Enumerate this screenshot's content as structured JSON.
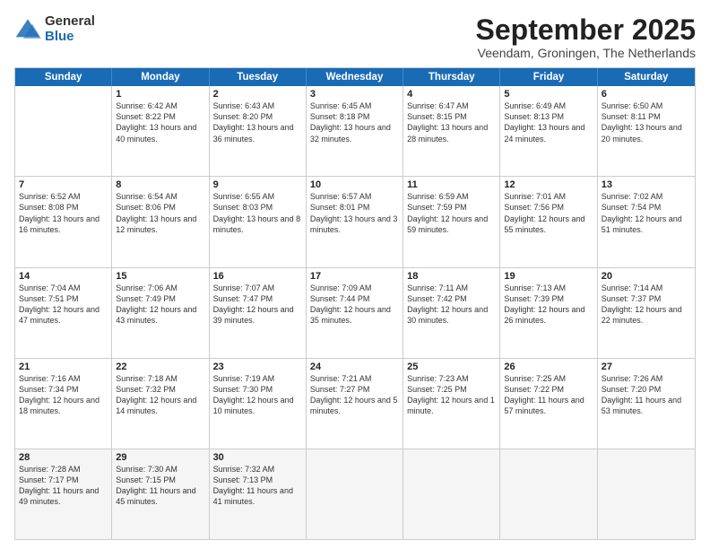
{
  "logo": {
    "general": "General",
    "blue": "Blue"
  },
  "title": {
    "month": "September 2025",
    "location": "Veendam, Groningen, The Netherlands"
  },
  "header": {
    "days": [
      "Sunday",
      "Monday",
      "Tuesday",
      "Wednesday",
      "Thursday",
      "Friday",
      "Saturday"
    ]
  },
  "weeks": [
    [
      {
        "day": "",
        "sunrise": "",
        "sunset": "",
        "daylight": ""
      },
      {
        "day": "1",
        "sunrise": "Sunrise: 6:42 AM",
        "sunset": "Sunset: 8:22 PM",
        "daylight": "Daylight: 13 hours and 40 minutes."
      },
      {
        "day": "2",
        "sunrise": "Sunrise: 6:43 AM",
        "sunset": "Sunset: 8:20 PM",
        "daylight": "Daylight: 13 hours and 36 minutes."
      },
      {
        "day": "3",
        "sunrise": "Sunrise: 6:45 AM",
        "sunset": "Sunset: 8:18 PM",
        "daylight": "Daylight: 13 hours and 32 minutes."
      },
      {
        "day": "4",
        "sunrise": "Sunrise: 6:47 AM",
        "sunset": "Sunset: 8:15 PM",
        "daylight": "Daylight: 13 hours and 28 minutes."
      },
      {
        "day": "5",
        "sunrise": "Sunrise: 6:49 AM",
        "sunset": "Sunset: 8:13 PM",
        "daylight": "Daylight: 13 hours and 24 minutes."
      },
      {
        "day": "6",
        "sunrise": "Sunrise: 6:50 AM",
        "sunset": "Sunset: 8:11 PM",
        "daylight": "Daylight: 13 hours and 20 minutes."
      }
    ],
    [
      {
        "day": "7",
        "sunrise": "Sunrise: 6:52 AM",
        "sunset": "Sunset: 8:08 PM",
        "daylight": "Daylight: 13 hours and 16 minutes."
      },
      {
        "day": "8",
        "sunrise": "Sunrise: 6:54 AM",
        "sunset": "Sunset: 8:06 PM",
        "daylight": "Daylight: 13 hours and 12 minutes."
      },
      {
        "day": "9",
        "sunrise": "Sunrise: 6:55 AM",
        "sunset": "Sunset: 8:03 PM",
        "daylight": "Daylight: 13 hours and 8 minutes."
      },
      {
        "day": "10",
        "sunrise": "Sunrise: 6:57 AM",
        "sunset": "Sunset: 8:01 PM",
        "daylight": "Daylight: 13 hours and 3 minutes."
      },
      {
        "day": "11",
        "sunrise": "Sunrise: 6:59 AM",
        "sunset": "Sunset: 7:59 PM",
        "daylight": "Daylight: 12 hours and 59 minutes."
      },
      {
        "day": "12",
        "sunrise": "Sunrise: 7:01 AM",
        "sunset": "Sunset: 7:56 PM",
        "daylight": "Daylight: 12 hours and 55 minutes."
      },
      {
        "day": "13",
        "sunrise": "Sunrise: 7:02 AM",
        "sunset": "Sunset: 7:54 PM",
        "daylight": "Daylight: 12 hours and 51 minutes."
      }
    ],
    [
      {
        "day": "14",
        "sunrise": "Sunrise: 7:04 AM",
        "sunset": "Sunset: 7:51 PM",
        "daylight": "Daylight: 12 hours and 47 minutes."
      },
      {
        "day": "15",
        "sunrise": "Sunrise: 7:06 AM",
        "sunset": "Sunset: 7:49 PM",
        "daylight": "Daylight: 12 hours and 43 minutes."
      },
      {
        "day": "16",
        "sunrise": "Sunrise: 7:07 AM",
        "sunset": "Sunset: 7:47 PM",
        "daylight": "Daylight: 12 hours and 39 minutes."
      },
      {
        "day": "17",
        "sunrise": "Sunrise: 7:09 AM",
        "sunset": "Sunset: 7:44 PM",
        "daylight": "Daylight: 12 hours and 35 minutes."
      },
      {
        "day": "18",
        "sunrise": "Sunrise: 7:11 AM",
        "sunset": "Sunset: 7:42 PM",
        "daylight": "Daylight: 12 hours and 30 minutes."
      },
      {
        "day": "19",
        "sunrise": "Sunrise: 7:13 AM",
        "sunset": "Sunset: 7:39 PM",
        "daylight": "Daylight: 12 hours and 26 minutes."
      },
      {
        "day": "20",
        "sunrise": "Sunrise: 7:14 AM",
        "sunset": "Sunset: 7:37 PM",
        "daylight": "Daylight: 12 hours and 22 minutes."
      }
    ],
    [
      {
        "day": "21",
        "sunrise": "Sunrise: 7:16 AM",
        "sunset": "Sunset: 7:34 PM",
        "daylight": "Daylight: 12 hours and 18 minutes."
      },
      {
        "day": "22",
        "sunrise": "Sunrise: 7:18 AM",
        "sunset": "Sunset: 7:32 PM",
        "daylight": "Daylight: 12 hours and 14 minutes."
      },
      {
        "day": "23",
        "sunrise": "Sunrise: 7:19 AM",
        "sunset": "Sunset: 7:30 PM",
        "daylight": "Daylight: 12 hours and 10 minutes."
      },
      {
        "day": "24",
        "sunrise": "Sunrise: 7:21 AM",
        "sunset": "Sunset: 7:27 PM",
        "daylight": "Daylight: 12 hours and 5 minutes."
      },
      {
        "day": "25",
        "sunrise": "Sunrise: 7:23 AM",
        "sunset": "Sunset: 7:25 PM",
        "daylight": "Daylight: 12 hours and 1 minute."
      },
      {
        "day": "26",
        "sunrise": "Sunrise: 7:25 AM",
        "sunset": "Sunset: 7:22 PM",
        "daylight": "Daylight: 11 hours and 57 minutes."
      },
      {
        "day": "27",
        "sunrise": "Sunrise: 7:26 AM",
        "sunset": "Sunset: 7:20 PM",
        "daylight": "Daylight: 11 hours and 53 minutes."
      }
    ],
    [
      {
        "day": "28",
        "sunrise": "Sunrise: 7:28 AM",
        "sunset": "Sunset: 7:17 PM",
        "daylight": "Daylight: 11 hours and 49 minutes."
      },
      {
        "day": "29",
        "sunrise": "Sunrise: 7:30 AM",
        "sunset": "Sunset: 7:15 PM",
        "daylight": "Daylight: 11 hours and 45 minutes."
      },
      {
        "day": "30",
        "sunrise": "Sunrise: 7:32 AM",
        "sunset": "Sunset: 7:13 PM",
        "daylight": "Daylight: 11 hours and 41 minutes."
      },
      {
        "day": "",
        "sunrise": "",
        "sunset": "",
        "daylight": ""
      },
      {
        "day": "",
        "sunrise": "",
        "sunset": "",
        "daylight": ""
      },
      {
        "day": "",
        "sunrise": "",
        "sunset": "",
        "daylight": ""
      },
      {
        "day": "",
        "sunrise": "",
        "sunset": "",
        "daylight": ""
      }
    ]
  ]
}
